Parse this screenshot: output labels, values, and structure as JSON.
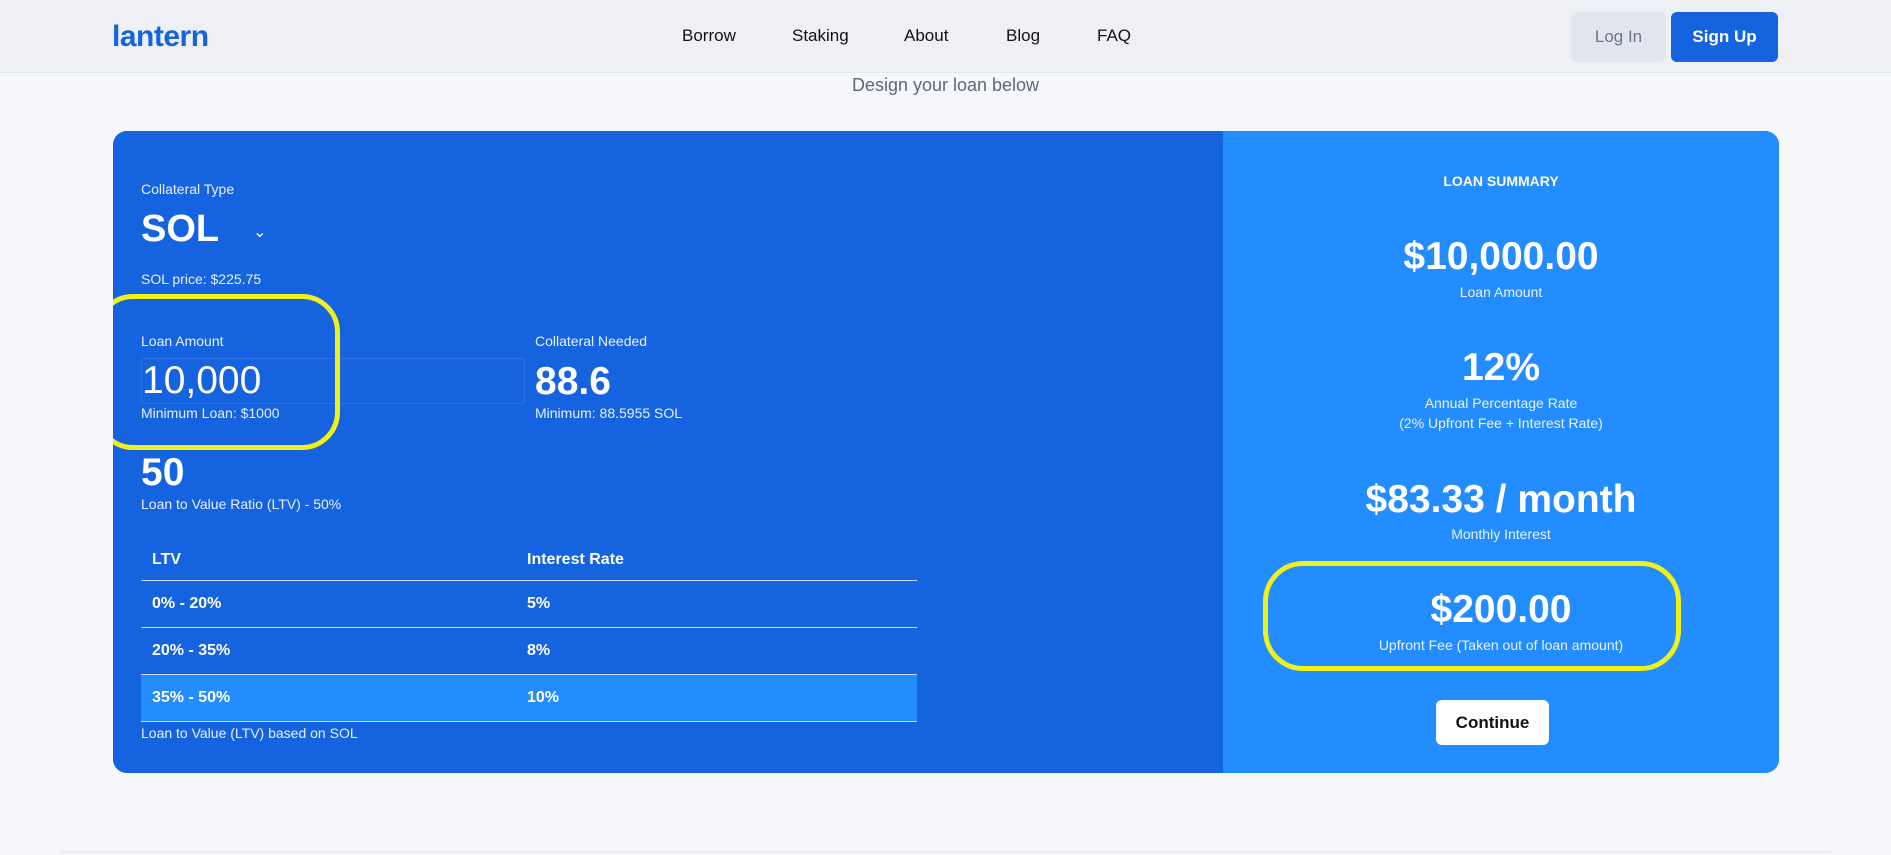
{
  "header": {
    "logo": "lantern",
    "nav": [
      "Borrow",
      "Staking",
      "About",
      "Blog",
      "FAQ"
    ],
    "login_label": "Log In",
    "signup_label": "Sign Up"
  },
  "subtitle": "Design your loan below",
  "form": {
    "collateral_type_label": "Collateral Type",
    "collateral_type_value": "SOL",
    "price_text": "SOL price: $225.75",
    "loan_amount_label": "Loan Amount",
    "loan_amount_value": "10,000",
    "min_loan_text": "Minimum Loan: $1000",
    "collateral_needed_label": "Collateral Needed",
    "collateral_needed_value": "88.6",
    "collateral_min_text": "Minimum: 88.5955 SOL",
    "ltv_value": "50",
    "ltv_label": "Loan to Value Ratio (LTV) - 50%",
    "table": {
      "headers": [
        "LTV",
        "Interest Rate"
      ],
      "rows": [
        [
          "0% - 20%",
          "5%"
        ],
        [
          "20% - 35%",
          "8%"
        ],
        [
          "35% - 50%",
          "10%"
        ]
      ],
      "active_row": 2
    },
    "footnote": "Loan to Value (LTV) based on SOL"
  },
  "summary": {
    "title": "LOAN SUMMARY",
    "loan_amount": "$10,000.00",
    "loan_amount_label": "Loan Amount",
    "apr": "12%",
    "apr_label": "Annual Percentage Rate",
    "apr_sublabel": "(2% Upfront Fee + Interest Rate)",
    "monthly": "$83.33 / month",
    "monthly_label": "Monthly Interest",
    "upfront_fee": "$200.00",
    "upfront_fee_label": "Upfront Fee (Taken out of loan amount)",
    "continue_label": "Continue"
  },
  "colors": {
    "brand_blue": "#1663e0",
    "summary_blue": "#238cfe",
    "highlight_yellow": "#f0f01a"
  }
}
